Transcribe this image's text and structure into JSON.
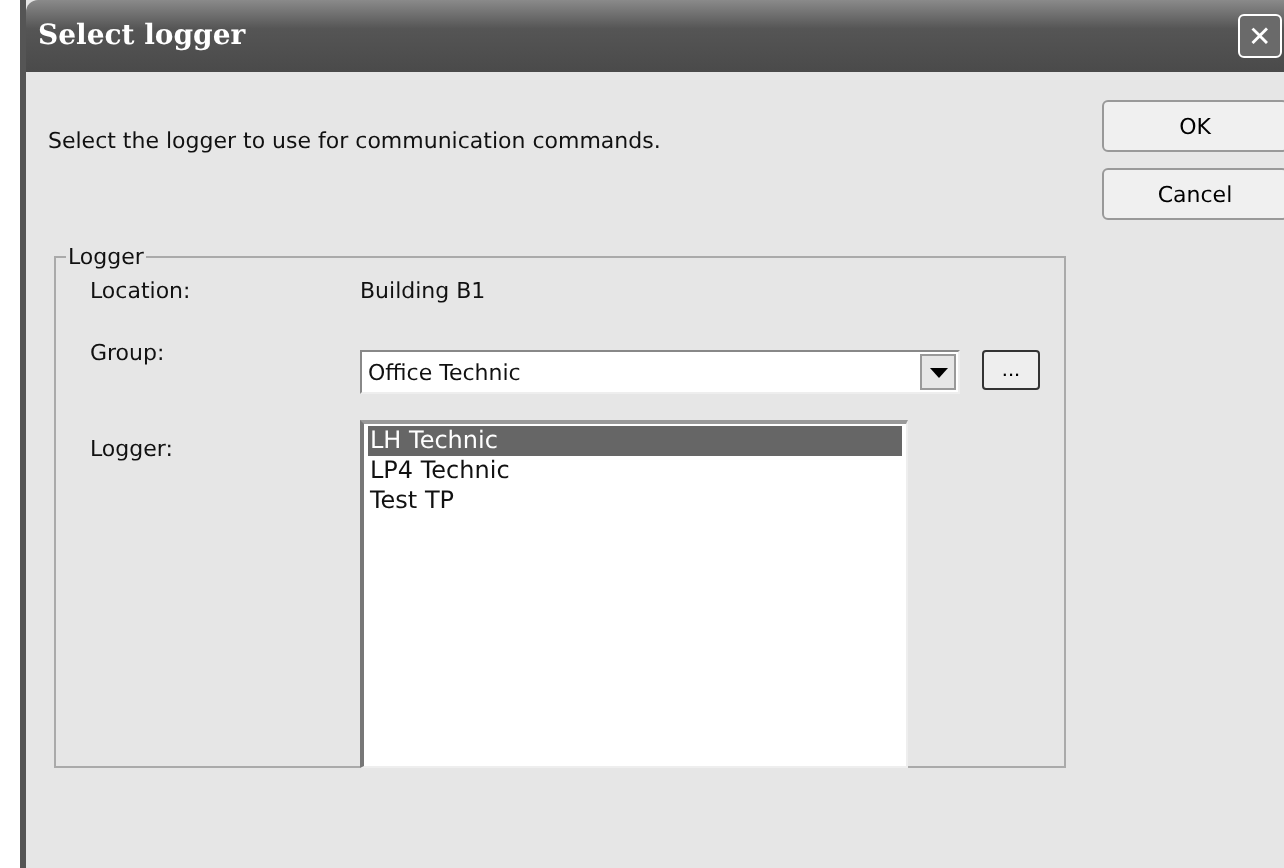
{
  "window": {
    "title": "Select logger",
    "close": "✕"
  },
  "instruction": "Select the logger to use for communication commands.",
  "buttons": [
    {
      "label": "OK"
    },
    {
      "label": "Cancel"
    }
  ],
  "group_box": {
    "legend": "Logger",
    "location": {
      "label": "Location:",
      "value": "Building B1"
    },
    "group": {
      "label": "Group:",
      "value": "Office Technic",
      "browse": "..."
    },
    "logger": {
      "label": "Logger:",
      "items": [
        {
          "name": "LH Technic",
          "selected": true
        },
        {
          "name": "LP4 Technic",
          "selected": false
        },
        {
          "name": "Test TP",
          "selected": false
        }
      ]
    }
  }
}
